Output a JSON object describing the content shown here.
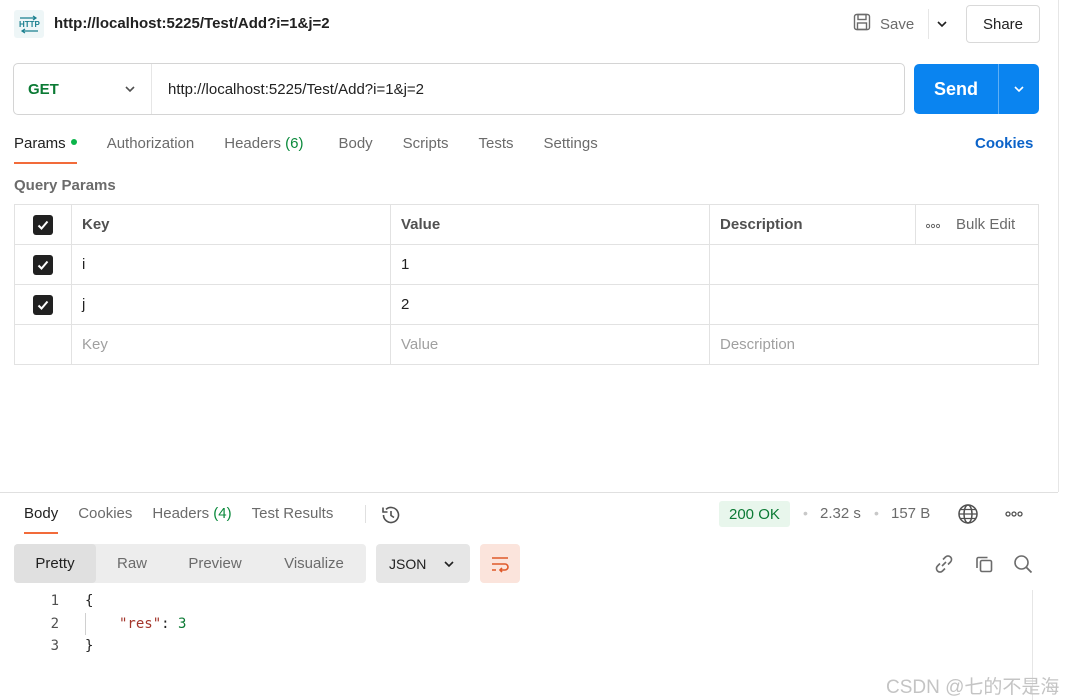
{
  "tab": {
    "title": "http://localhost:5225/Test/Add?i=1&j=2",
    "icon": "http-request-icon"
  },
  "toolbar": {
    "save_label": "Save",
    "share_label": "Share"
  },
  "request": {
    "method": "GET",
    "url": "http://localhost:5225/Test/Add?i=1&j=2",
    "send_label": "Send"
  },
  "request_tabs": {
    "params": "Params",
    "authorization": "Authorization",
    "headers": "Headers",
    "headers_count": "(6)",
    "body": "Body",
    "scripts": "Scripts",
    "tests": "Tests",
    "settings": "Settings",
    "cookies": "Cookies"
  },
  "query_params": {
    "label": "Query Params",
    "headers": {
      "key": "Key",
      "value": "Value",
      "description": "Description",
      "bulk_edit": "Bulk Edit"
    },
    "rows": [
      {
        "key": "i",
        "value": "1",
        "description": "",
        "checked": true
      },
      {
        "key": "j",
        "value": "2",
        "description": "",
        "checked": true
      }
    ],
    "placeholders": {
      "key": "Key",
      "value": "Value",
      "description": "Description"
    }
  },
  "response_tabs": {
    "body": "Body",
    "cookies": "Cookies",
    "headers": "Headers",
    "headers_count": "(4)",
    "test_results": "Test Results"
  },
  "response_meta": {
    "status": "200 OK",
    "time": "2.32 s",
    "size": "157 B",
    "status_color": "#0b7a34"
  },
  "view_modes": {
    "pretty": "Pretty",
    "raw": "Raw",
    "preview": "Preview",
    "visualize": "Visualize",
    "format": "JSON"
  },
  "code": {
    "lines": [
      "1",
      "2",
      "3"
    ],
    "open_brace": "{",
    "key": "\"res\"",
    "colon": ": ",
    "value": "3",
    "close_brace": "}"
  },
  "watermark": "CSDN @七的不是海",
  "colors": {
    "accent": "#f26b3a",
    "send": "#0a84f0",
    "link": "#0b63c9"
  }
}
